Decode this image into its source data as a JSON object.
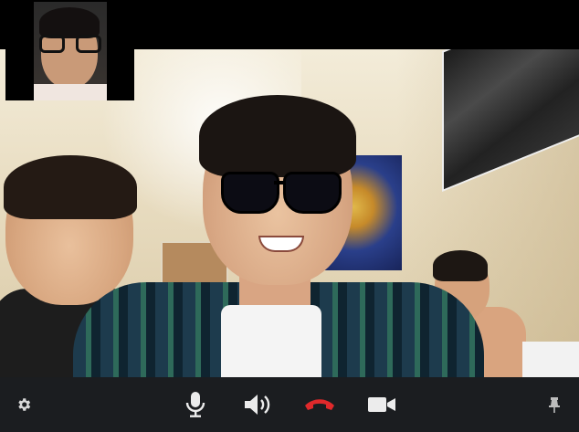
{
  "call": {
    "remote_video_name": "remote-participant-video",
    "self_view_name": "self-view-thumbnail"
  },
  "controls": [
    {
      "key": "settings",
      "icon": "gear-icon"
    },
    {
      "key": "mic",
      "icon": "microphone-icon"
    },
    {
      "key": "speaker",
      "icon": "speaker-icon"
    },
    {
      "key": "hangup",
      "icon": "hang-up-icon"
    },
    {
      "key": "camera",
      "icon": "video-camera-icon"
    },
    {
      "key": "pin",
      "icon": "pin-icon"
    }
  ],
  "colors": {
    "control_bar_bg": "#1b1d20",
    "icon": "#e6e6e6",
    "hangup_red": "#e0292b",
    "window_bg": "#000000"
  }
}
